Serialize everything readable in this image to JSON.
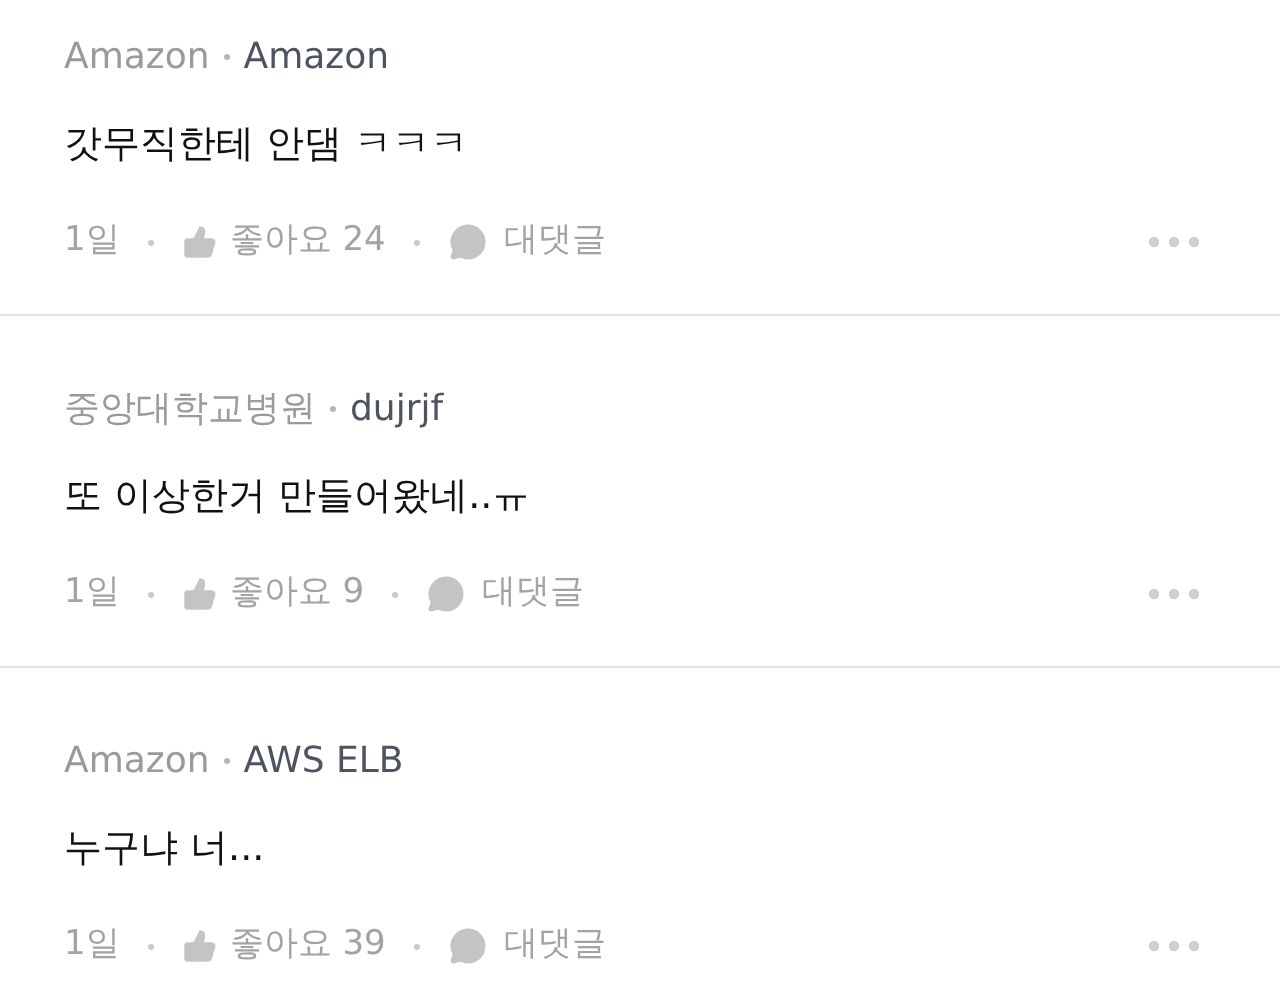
{
  "comments": [
    {
      "organization": "Amazon",
      "author": "Amazon",
      "text": "갓무직한테 안댐 ㅋㅋㅋ",
      "time": "1일",
      "likes": "좋아요 24",
      "reply": "대댓글"
    },
    {
      "organization": "중앙대학교병원",
      "author": "dujrjf",
      "text": "또 이상한거 만들어왔네..ㅠ",
      "time": "1일",
      "likes": "좋아요 9",
      "reply": "대댓글"
    },
    {
      "organization": "Amazon",
      "author": "AWS ELB",
      "text": "누구냐 너...",
      "time": "1일",
      "likes": "좋아요 39",
      "reply": "대댓글"
    }
  ]
}
